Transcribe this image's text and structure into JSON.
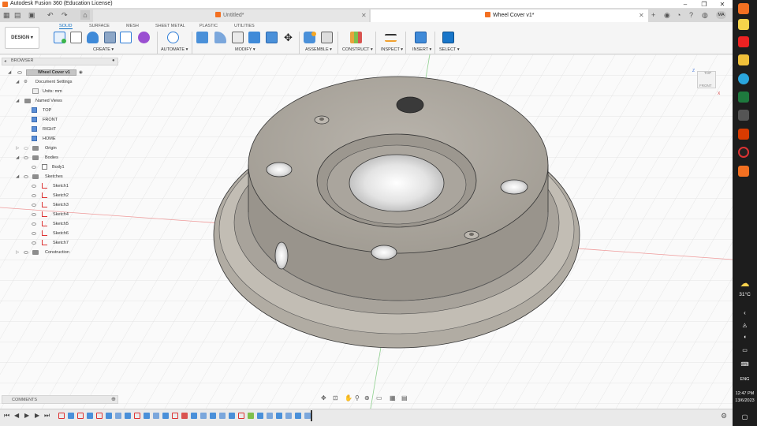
{
  "app": {
    "title": "Autodesk Fusion 360 (Education License)"
  },
  "tabs": [
    {
      "label": "Untitled*",
      "active": false
    },
    {
      "label": "Wheel Cover v1*",
      "active": true
    }
  ],
  "ribbon": {
    "design_label": "DESIGN ▾",
    "tabs": [
      "SOLID",
      "SURFACE",
      "MESH",
      "SHEET METAL",
      "PLASTIC",
      "UTILITIES"
    ],
    "active_tab": "SOLID",
    "groups": [
      "CREATE ▾",
      "AUTOMATE ▾",
      "MODIFY ▾",
      "ASSEMBLE ▾",
      "CONSTRUCT ▾",
      "INSPECT ▾",
      "INSERT ▾",
      "SELECT ▾"
    ]
  },
  "browser": {
    "title": "BROWSER",
    "root": "Wheel Cover v1",
    "document_settings": "Document Settings",
    "units": "Units: mm",
    "named_views": "Named Views",
    "views": [
      "TOP",
      "FRONT",
      "RIGHT",
      "HOME"
    ],
    "origin": "Origin",
    "bodies": "Bodies",
    "body1": "Body1",
    "sketches": "Sketches",
    "sketch_items": [
      "Sketch1",
      "Sketch2",
      "Sketch3",
      "Sketch4",
      "Sketch5",
      "Sketch6",
      "Sketch7"
    ],
    "construction": "Construction"
  },
  "comments": {
    "label": "COMMENTS"
  },
  "viewcube": {
    "top": "TOP",
    "front": "FRONT",
    "x": "X",
    "z": "Z"
  },
  "taskbar": {
    "weather": "31°C",
    "tray_lang": "ENG",
    "time": "12:47 PM",
    "date": "13/6/2023"
  },
  "user": {
    "initials": "MA"
  },
  "colors": {
    "accent": "#0a6cc2",
    "model_face": "#a9a39b",
    "model_rim": "#c7c2b8",
    "brand": "#f37021"
  }
}
